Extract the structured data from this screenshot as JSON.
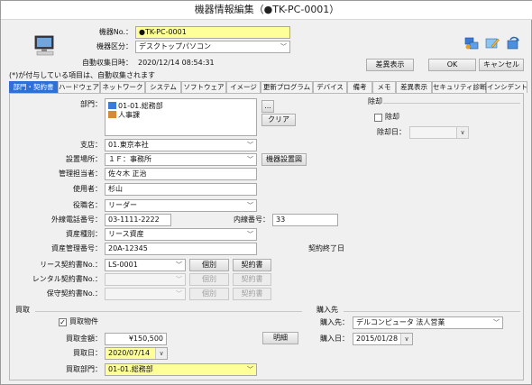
{
  "window": {
    "title": "機器情報編集（●TK-PC-0001）"
  },
  "header": {
    "device_no_label": "機器No.：",
    "device_no_value": "●TK-PC-0001",
    "device_type_label": "機器区分：",
    "device_type_value": "デスクトップパソコン",
    "collected_label": "自動収集日時：",
    "collected_value": "2020/12/14 08:54:31",
    "note": "(*)が付与している項目は、自動収集されます",
    "diff_button": "差異表示",
    "ok_button": "OK",
    "cancel_button": "キャンセル"
  },
  "tabs": [
    {
      "label": "部門・契約書",
      "active": true
    },
    {
      "label": "ハードウェア",
      "active": false
    },
    {
      "label": "ネットワーク",
      "active": false
    },
    {
      "label": "システム",
      "active": false
    },
    {
      "label": "ソフトウェア",
      "active": false
    },
    {
      "label": "イメージ",
      "active": false
    },
    {
      "label": "更新プログラム",
      "active": false
    },
    {
      "label": "デバイス",
      "active": false
    },
    {
      "label": "備考",
      "active": false
    },
    {
      "label": "メモ",
      "active": false
    },
    {
      "label": "差異表示",
      "active": false
    },
    {
      "label": "セキュリティ診断",
      "active": false
    },
    {
      "label": "インシデント",
      "active": false
    }
  ],
  "form": {
    "dept_label": "部門：",
    "dept_items": [
      "01-01.総務部",
      "人事課"
    ],
    "browse_button": "...",
    "clear_button": "クリア",
    "branch_label": "支店：",
    "branch_value": "01.東京本社",
    "location_label": "設置場所：",
    "location_value": "１Ｆ：事務所",
    "location_figure_button": "機器設置図",
    "manager_label": "管理担当者：",
    "manager_value": "佐々木 正治",
    "user_label": "使用者：",
    "user_value": "杉山",
    "position_label": "役職名：",
    "position_value": "リーダー",
    "ext_phone_label": "外線電話番号：",
    "ext_phone_value": "03-1111-2222",
    "inline_label": "内線番号：",
    "inline_value": "33",
    "asset_type_label": "資産種別：",
    "asset_type_value": "リース資産",
    "asset_no_label": "資産管理番号：",
    "asset_no_value": "20A-12345",
    "contract_end": "契約終了日",
    "lease_label": "リース契約書No.：",
    "lease_value": "LS-0001",
    "rental_label": "レンタル契約書No.：",
    "maint_label": "保守契約書No.：",
    "individual_button": "個別",
    "contract_button": "契約書"
  },
  "removal": {
    "section_label": "除却",
    "checkbox_label": "除却",
    "date_label": "除却日："
  },
  "purchase": {
    "section_label": "買取",
    "checkbox_label": "買取物件",
    "amount_label": "買取金額：",
    "amount_value": "¥150,500",
    "detail_button": "明細",
    "date_label": "買取日：",
    "date_value": "2020/07/14",
    "dept_label": "買取部門：",
    "dept_value": "01-01.総務部"
  },
  "vendor": {
    "section_label": "購入先",
    "vendor_label": "購入先：",
    "vendor_value": "デルコンピュータ 法人営業",
    "date_label": "購入日：",
    "date_value": "2015/01/28"
  },
  "icons": {
    "computer": "computer-icon",
    "network": "network-icon",
    "edit": "edit-icon",
    "refresh": "refresh-icon"
  }
}
